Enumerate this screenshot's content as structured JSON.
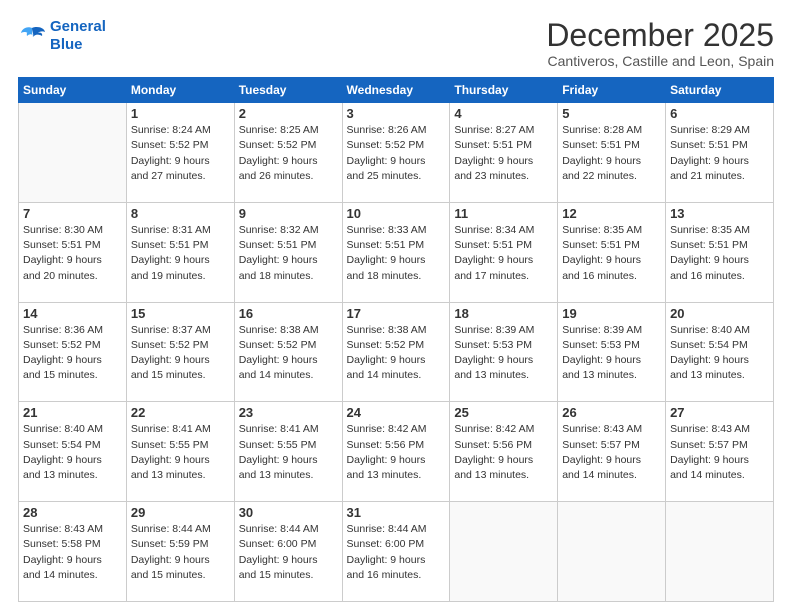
{
  "logo": {
    "line1": "General",
    "line2": "Blue"
  },
  "title": "December 2025",
  "subtitle": "Cantiveros, Castille and Leon, Spain",
  "header": {
    "days": [
      "Sunday",
      "Monday",
      "Tuesday",
      "Wednesday",
      "Thursday",
      "Friday",
      "Saturday"
    ]
  },
  "weeks": [
    [
      {
        "day": "",
        "info": ""
      },
      {
        "day": "1",
        "info": "Sunrise: 8:24 AM\nSunset: 5:52 PM\nDaylight: 9 hours\nand 27 minutes."
      },
      {
        "day": "2",
        "info": "Sunrise: 8:25 AM\nSunset: 5:52 PM\nDaylight: 9 hours\nand 26 minutes."
      },
      {
        "day": "3",
        "info": "Sunrise: 8:26 AM\nSunset: 5:52 PM\nDaylight: 9 hours\nand 25 minutes."
      },
      {
        "day": "4",
        "info": "Sunrise: 8:27 AM\nSunset: 5:51 PM\nDaylight: 9 hours\nand 23 minutes."
      },
      {
        "day": "5",
        "info": "Sunrise: 8:28 AM\nSunset: 5:51 PM\nDaylight: 9 hours\nand 22 minutes."
      },
      {
        "day": "6",
        "info": "Sunrise: 8:29 AM\nSunset: 5:51 PM\nDaylight: 9 hours\nand 21 minutes."
      }
    ],
    [
      {
        "day": "7",
        "info": "Sunrise: 8:30 AM\nSunset: 5:51 PM\nDaylight: 9 hours\nand 20 minutes."
      },
      {
        "day": "8",
        "info": "Sunrise: 8:31 AM\nSunset: 5:51 PM\nDaylight: 9 hours\nand 19 minutes."
      },
      {
        "day": "9",
        "info": "Sunrise: 8:32 AM\nSunset: 5:51 PM\nDaylight: 9 hours\nand 18 minutes."
      },
      {
        "day": "10",
        "info": "Sunrise: 8:33 AM\nSunset: 5:51 PM\nDaylight: 9 hours\nand 18 minutes."
      },
      {
        "day": "11",
        "info": "Sunrise: 8:34 AM\nSunset: 5:51 PM\nDaylight: 9 hours\nand 17 minutes."
      },
      {
        "day": "12",
        "info": "Sunrise: 8:35 AM\nSunset: 5:51 PM\nDaylight: 9 hours\nand 16 minutes."
      },
      {
        "day": "13",
        "info": "Sunrise: 8:35 AM\nSunset: 5:51 PM\nDaylight: 9 hours\nand 16 minutes."
      }
    ],
    [
      {
        "day": "14",
        "info": "Sunrise: 8:36 AM\nSunset: 5:52 PM\nDaylight: 9 hours\nand 15 minutes."
      },
      {
        "day": "15",
        "info": "Sunrise: 8:37 AM\nSunset: 5:52 PM\nDaylight: 9 hours\nand 15 minutes."
      },
      {
        "day": "16",
        "info": "Sunrise: 8:38 AM\nSunset: 5:52 PM\nDaylight: 9 hours\nand 14 minutes."
      },
      {
        "day": "17",
        "info": "Sunrise: 8:38 AM\nSunset: 5:52 PM\nDaylight: 9 hours\nand 14 minutes."
      },
      {
        "day": "18",
        "info": "Sunrise: 8:39 AM\nSunset: 5:53 PM\nDaylight: 9 hours\nand 13 minutes."
      },
      {
        "day": "19",
        "info": "Sunrise: 8:39 AM\nSunset: 5:53 PM\nDaylight: 9 hours\nand 13 minutes."
      },
      {
        "day": "20",
        "info": "Sunrise: 8:40 AM\nSunset: 5:54 PM\nDaylight: 9 hours\nand 13 minutes."
      }
    ],
    [
      {
        "day": "21",
        "info": "Sunrise: 8:40 AM\nSunset: 5:54 PM\nDaylight: 9 hours\nand 13 minutes."
      },
      {
        "day": "22",
        "info": "Sunrise: 8:41 AM\nSunset: 5:55 PM\nDaylight: 9 hours\nand 13 minutes."
      },
      {
        "day": "23",
        "info": "Sunrise: 8:41 AM\nSunset: 5:55 PM\nDaylight: 9 hours\nand 13 minutes."
      },
      {
        "day": "24",
        "info": "Sunrise: 8:42 AM\nSunset: 5:56 PM\nDaylight: 9 hours\nand 13 minutes."
      },
      {
        "day": "25",
        "info": "Sunrise: 8:42 AM\nSunset: 5:56 PM\nDaylight: 9 hours\nand 13 minutes."
      },
      {
        "day": "26",
        "info": "Sunrise: 8:43 AM\nSunset: 5:57 PM\nDaylight: 9 hours\nand 14 minutes."
      },
      {
        "day": "27",
        "info": "Sunrise: 8:43 AM\nSunset: 5:57 PM\nDaylight: 9 hours\nand 14 minutes."
      }
    ],
    [
      {
        "day": "28",
        "info": "Sunrise: 8:43 AM\nSunset: 5:58 PM\nDaylight: 9 hours\nand 14 minutes."
      },
      {
        "day": "29",
        "info": "Sunrise: 8:44 AM\nSunset: 5:59 PM\nDaylight: 9 hours\nand 15 minutes."
      },
      {
        "day": "30",
        "info": "Sunrise: 8:44 AM\nSunset: 6:00 PM\nDaylight: 9 hours\nand 15 minutes."
      },
      {
        "day": "31",
        "info": "Sunrise: 8:44 AM\nSunset: 6:00 PM\nDaylight: 9 hours\nand 16 minutes."
      },
      {
        "day": "",
        "info": ""
      },
      {
        "day": "",
        "info": ""
      },
      {
        "day": "",
        "info": ""
      }
    ]
  ]
}
